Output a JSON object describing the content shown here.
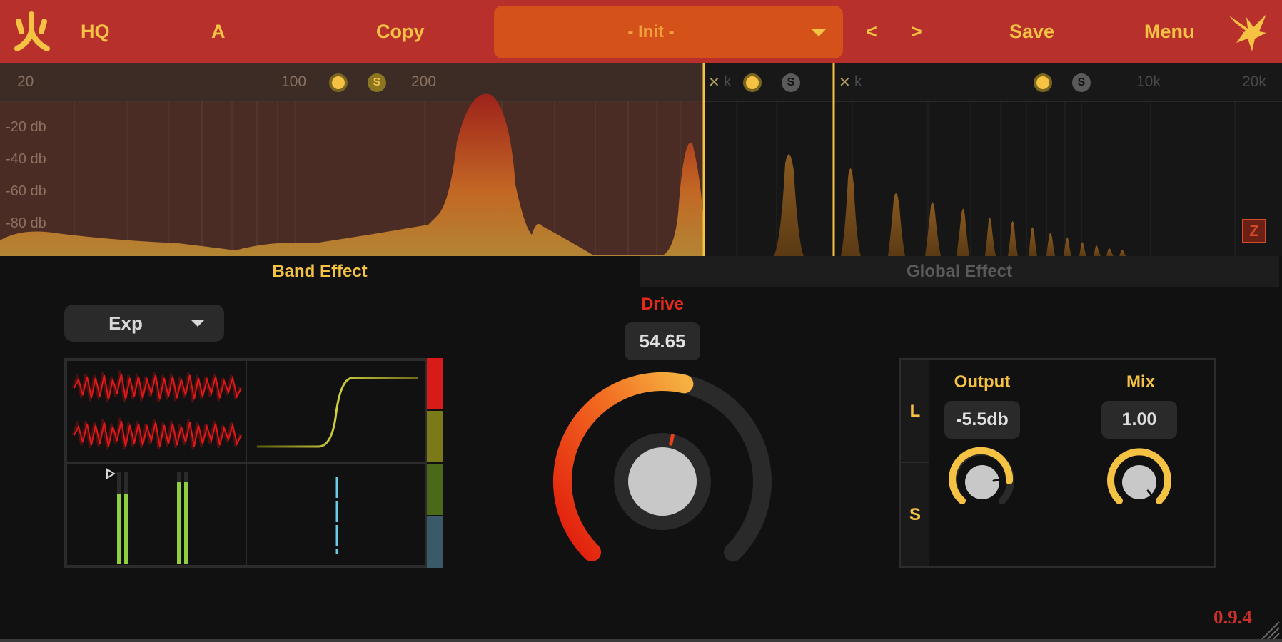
{
  "header": {
    "hq_label": "HQ",
    "ab_label": "A",
    "copy_label": "Copy",
    "preset_name": "- Init -",
    "prev_label": "<",
    "next_label": ">",
    "save_label": "Save",
    "menu_label": "Menu"
  },
  "spectrum": {
    "freq_labels": [
      "20",
      "100",
      "200",
      "10k",
      "20k"
    ],
    "db_labels": [
      "-20 db",
      "-40 db",
      "-60 db",
      "-80 db"
    ],
    "solo_label": "S",
    "k_label": "k",
    "zoom_label": "Z"
  },
  "tabs": {
    "band": "Band Effect",
    "global": "Global Effect"
  },
  "band": {
    "mode": "Exp",
    "drive_label": "Drive",
    "drive_value": "54.65",
    "drive_level": 0.5465
  },
  "output_mix": {
    "l_label": "L",
    "s_label": "S",
    "output_label": "Output",
    "output_value": "-5.5db",
    "mix_label": "Mix",
    "mix_value": "1.00"
  },
  "version": "0.9.4",
  "colors": {
    "accent": "#f5c244",
    "header_bg": "#b8302c",
    "preset_bg": "#d4511a",
    "drive_red": "#e42a1a",
    "background": "#111111"
  },
  "icons": {
    "logo": "fire-glyph-icon",
    "brand": "bird-logo-icon",
    "dropdown": "chevron-down-icon"
  }
}
